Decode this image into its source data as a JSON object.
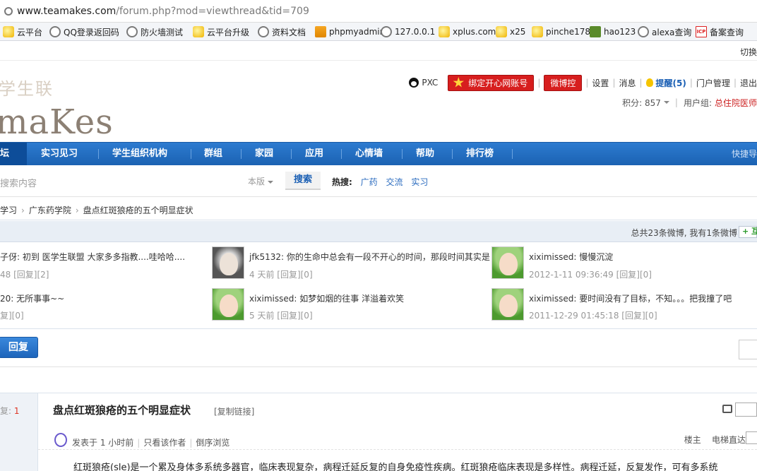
{
  "browser": {
    "url_host": "www.teamakes.com",
    "url_path": "/forum.php?mod=viewthread&tid=709"
  },
  "bookmarks": [
    {
      "label": "云平台",
      "icon": "cloud-icon"
    },
    {
      "label": "QQ登录返回码",
      "icon": "globe-icon"
    },
    {
      "label": "防火墙测试",
      "icon": "globe-icon"
    },
    {
      "label": "云平台升级",
      "icon": "cloud-icon"
    },
    {
      "label": "资料文档",
      "icon": "globe-icon"
    },
    {
      "label": "phpmyadmin",
      "icon": "pma-icon"
    },
    {
      "label": "127.0.0.1",
      "icon": "globe-icon"
    },
    {
      "label": "xplus.com",
      "icon": "cloud-icon"
    },
    {
      "label": "x25",
      "icon": "cloud-icon"
    },
    {
      "label": "pinche178",
      "icon": "cloud-icon"
    },
    {
      "label": "hao123",
      "icon": "box-icon"
    },
    {
      "label": "alexa查询",
      "icon": "globe-icon"
    },
    {
      "label": "备案查询",
      "icon": "icp-icon"
    }
  ],
  "switch_label": "切换",
  "site": {
    "logo_small": "学生联",
    "logo_big": "maKes"
  },
  "user_bar": {
    "username": "PXC",
    "kaixin_button": "绑定开心网账号",
    "weibo_button": "微博控",
    "settings": "设置",
    "messages": "消息",
    "reminders": "提醒(5)",
    "portal_admin": "门户管理",
    "logout": "退出",
    "points_label": "积分: 857",
    "usergroup_label": "用户组:",
    "usergroup_value": "总住院医师"
  },
  "nav": {
    "items": [
      "坛",
      "实习见习",
      "学生组织机构",
      "群组",
      "家园",
      "应用",
      "心情墙",
      "帮助",
      "排行榜"
    ],
    "right": "快捷导"
  },
  "search": {
    "placeholder": "搜索内容",
    "scope": "本版",
    "button": "搜索",
    "hot_label": "热搜:",
    "hot_keywords": [
      "广药",
      "交流",
      "实习"
    ]
  },
  "breadcrumb": [
    "学习",
    "广东药学院",
    "盘点红斑狼疮的五个明显症状"
  ],
  "weibo": {
    "summary": "总共23条微博, 我有1条微博",
    "add_label": "+ 互",
    "posts": [
      {
        "text": "子伢: 初到 医学生联盟 大家多多指教....哇哈哈....",
        "meta": "48 [回复][2]"
      },
      {
        "text": "jfk5132: 你的生命中总会有一段不开心的时间，那段时间其实是",
        "meta": "4 天前 [回复][0]"
      },
      {
        "text": "xiximissed: 慢慢沉淀",
        "meta": "2012-1-11 09:36:49 [回复][0]"
      },
      {
        "text": "20: 无所事事~~",
        "meta": "复][0]"
      },
      {
        "text": "xiximissed: 如梦如烟的往事  洋溢着欢笑",
        "meta": "5 天前 [回复][0]"
      },
      {
        "text": "xiximissed: 要时间没有了目标，不知。。。把我撞了吧",
        "meta": "2011-12-29 01:45:18 [回复][0]"
      }
    ]
  },
  "reply_button": "回复",
  "post": {
    "reply_count_label": "复:",
    "reply_count": "1",
    "title": "盘点红斑狼疮的五个明显症状",
    "copy_link": "[复制链接]",
    "posted": "发表于 1 小时前",
    "only_author": "只看该作者",
    "reverse": "倒序浏览",
    "floor": "楼主",
    "elevator": "电梯直达",
    "body_link": "红斑狼疮",
    "body_text": "(sle)是一个累及身体多系统多器官，临床表现复杂，病程迁延反复的自身免疫性疾病。红斑狼疮临床表现是多样性。病程迁延，反复发作，可有多系统"
  }
}
